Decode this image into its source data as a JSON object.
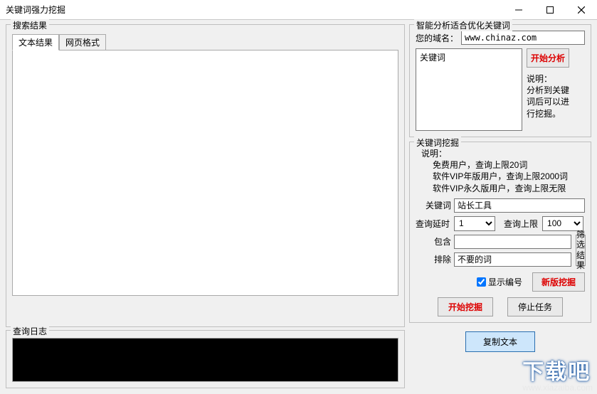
{
  "window": {
    "title": "关键词强力挖掘"
  },
  "left": {
    "searchResults": {
      "legend": "搜索结果",
      "tabs": [
        "文本结果",
        "网页格式"
      ],
      "activeTab": 0
    },
    "queryLog": {
      "legend": "查询日志"
    }
  },
  "analysis": {
    "legend": "智能分析适合优化关键词",
    "domainLabel": "您的域名：",
    "domainValue": "www.chinaz.com",
    "keywordLegend": "关键词",
    "startBtn": "开始分析",
    "desc1": "说明：",
    "desc2": "分析到关键词后可以进行挖掘。"
  },
  "mining": {
    "legend": "关键词挖掘",
    "descHead": "说明：",
    "desc": [
      "免费用户，查询上限20词",
      "软件VIP年版用户，查询上限2000词",
      "软件VIP永久版用户，查询上限无限"
    ],
    "keywordLabel": "关键词",
    "keywordValue": "站长工具",
    "delayLabel": "查询延时",
    "delayValue": "1",
    "limitLabel": "查询上限",
    "limitValue": "100",
    "includeLabel": "包含",
    "includeValue": "",
    "excludeLabel": "排除",
    "excludeValue": "不要的词",
    "filterBtn": "筛选结果",
    "showNumberLabel": "显示编号",
    "showNumberChecked": true,
    "newVersionBtn": "新版挖掘",
    "startBtn": "开始挖掘",
    "stopBtn": "停止任务"
  },
  "copyBtn": "复制文本",
  "watermark": {
    "big": "下载吧",
    "small": "www.xiazaiba.com"
  }
}
